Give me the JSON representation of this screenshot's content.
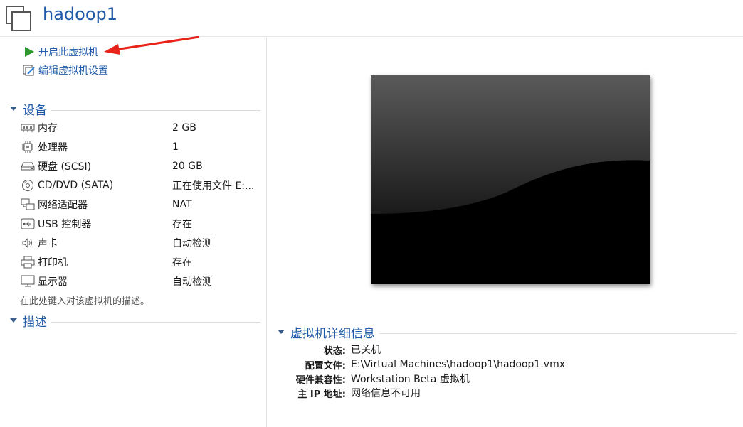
{
  "header": {
    "title": "hadoop1",
    "icon": "vm-window-icon"
  },
  "actions": {
    "start_label": "开启此虚拟机",
    "edit_label": "编辑虚拟机设置"
  },
  "devices": {
    "heading": "设备",
    "items": [
      {
        "icon": "memory-icon",
        "name": "内存",
        "value": "2 GB"
      },
      {
        "icon": "processor-icon",
        "name": "处理器",
        "value": "1"
      },
      {
        "icon": "hard-disk-icon",
        "name": "硬盘 (SCSI)",
        "value": "20 GB"
      },
      {
        "icon": "cd-dvd-icon",
        "name": "CD/DVD (SATA)",
        "value": "正在使用文件 E:..."
      },
      {
        "icon": "network-adapter-icon",
        "name": "网络适配器",
        "value": "NAT"
      },
      {
        "icon": "usb-icon",
        "name": "USB 控制器",
        "value": "存在"
      },
      {
        "icon": "sound-card-icon",
        "name": "声卡",
        "value": "自动检测"
      },
      {
        "icon": "printer-icon",
        "name": "打印机",
        "value": "存在"
      },
      {
        "icon": "display-icon",
        "name": "显示器",
        "value": "自动检测"
      }
    ]
  },
  "description": {
    "heading": "描述",
    "placeholder": "在此处键入对该虚拟机的描述。"
  },
  "details": {
    "heading": "虚拟机详细信息",
    "rows": [
      {
        "key": "状态:",
        "value": "已关机"
      },
      {
        "key": "配置文件:",
        "value": "E:\\Virtual Machines\\hadoop1\\hadoop1.vmx"
      },
      {
        "key": "硬件兼容性:",
        "value": "Workstation Beta 虚拟机"
      },
      {
        "key": "主 IP 地址:",
        "value": "网络信息不可用"
      }
    ]
  },
  "colors": {
    "accent": "#1e5aa8",
    "play": "#2e9a2e",
    "annotation_arrow": "#e8231a"
  }
}
